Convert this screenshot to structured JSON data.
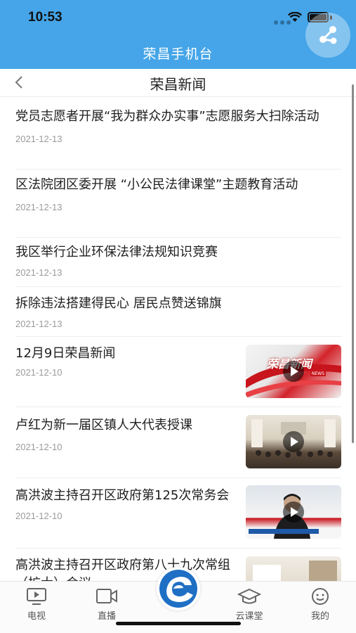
{
  "status": {
    "time": "10:53"
  },
  "header": {
    "app_title": "荣昌手机台"
  },
  "nav": {
    "page_title": "荣昌新闻"
  },
  "news": [
    {
      "title": "党员志愿者开展“我为群众办实事”志愿服务大扫除活动",
      "date": "2021-12-13"
    },
    {
      "title": "区法院团区委开展 “小公民法律课堂”主题教育活动",
      "date": "2021-12-13"
    },
    {
      "title": "我区举行企业环保法律法规知识竞赛",
      "date": "2021-12-13"
    },
    {
      "title": "拆除违法搭建得民心 居民点赞送锦旗",
      "date": "2021-12-13"
    },
    {
      "title": "12月9日荣昌新闻",
      "date": "2021-12-10",
      "thumb_text": "荣昌新闻",
      "thumb_sub": "NEWS"
    },
    {
      "title": "卢红为新一届区镇人大代表授课",
      "date": "2021-12-10"
    },
    {
      "title": "高洪波主持召开区政府第125次常务会",
      "date": "2021-12-10"
    },
    {
      "title": "高洪波主持召开区政府第八十九次常组（扩大）会议",
      "date": ""
    }
  ],
  "tabs": [
    {
      "label": "电视",
      "icon": "tv-icon"
    },
    {
      "label": "直播",
      "icon": "video-camera-icon"
    },
    {
      "label": "云课堂",
      "icon": "graduation-cap-icon"
    },
    {
      "label": "我的",
      "icon": "smiley-face-icon"
    }
  ],
  "colors": {
    "accent": "#45a5e8",
    "logo": "#1f6fc4"
  }
}
